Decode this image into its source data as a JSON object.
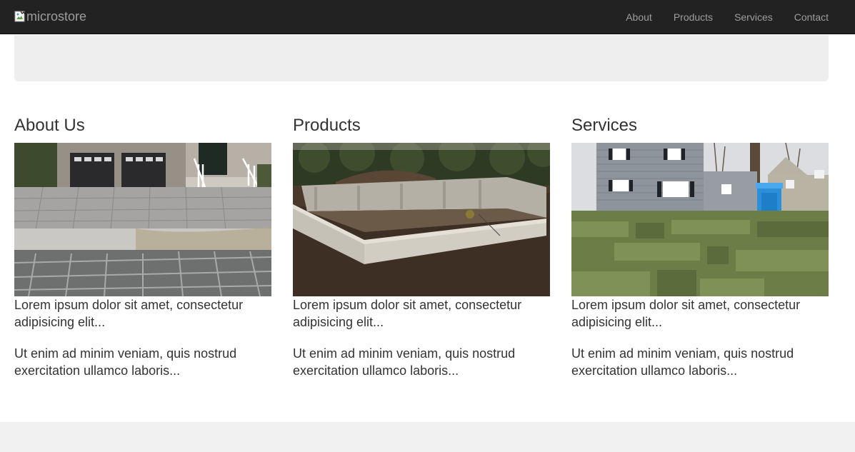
{
  "navbar": {
    "brand_alt": "microstore",
    "links": [
      {
        "label": "About"
      },
      {
        "label": "Products"
      },
      {
        "label": "Services"
      },
      {
        "label": "Contact"
      }
    ]
  },
  "sections": [
    {
      "heading": "About Us",
      "image_subject": "paver driveway in front of a two-car garage",
      "text1": "Lorem ipsum dolor sit amet, consectetur adipisicing elit...",
      "text2": "Ut enim ad minim veniam, quis nostrud exercitation ullamco laboris..."
    },
    {
      "heading": "Products",
      "image_subject": "concrete foundation walls on a dirt site",
      "text1": "Lorem ipsum dolor sit amet, consectetur adipisicing elit...",
      "text2": "Ut enim ad minim veniam, quis nostrud exercitation ullamco laboris..."
    },
    {
      "heading": "Services",
      "image_subject": "gray house with fresh sod lawn and blue portable toilet",
      "text1": "Lorem ipsum dolor sit amet, consectetur adipisicing elit...",
      "text2": "Ut enim ad minim veniam, quis nostrud exercitation ullamco laboris..."
    }
  ],
  "colors": {
    "navbar_bg": "#222222",
    "nav_text": "#9d9d9d",
    "jumbotron_bg": "#eeeeee",
    "body_text": "#333333",
    "footer_bg": "#f1f1f1"
  }
}
